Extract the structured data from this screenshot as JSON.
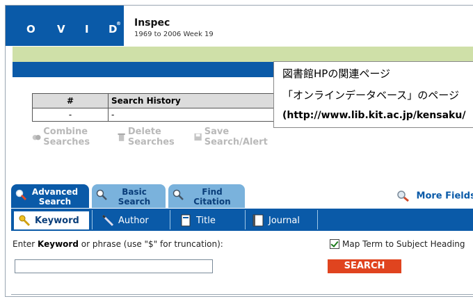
{
  "header": {
    "brand_letters": [
      "O",
      "V",
      "I",
      "D"
    ],
    "brand_mark": "®",
    "database_title": "Inspec",
    "database_range": "1969 to 2006 Week 19"
  },
  "overlay_note": {
    "line1": "図書館HPの関連ページ",
    "line2": "「オンラインデータベース」のページ",
    "line3": "(http://www.lib.kit.ac.jp/kensaku/"
  },
  "search_history": {
    "columns": [
      "#",
      "Search History"
    ],
    "rows": [
      [
        "-",
        "-"
      ]
    ]
  },
  "history_actions": {
    "combine": "Combine Searches",
    "delete": "Delete Searches",
    "save": "Save Search/Alert"
  },
  "search_tabs": [
    {
      "line1": "Advanced",
      "line2": "Search"
    },
    {
      "line1": "Basic",
      "line2": "Search"
    },
    {
      "line1": "Find",
      "line2": "Citation"
    }
  ],
  "more_fields": "More Fields",
  "field_tabs": {
    "keyword": "Keyword",
    "author": "Author",
    "title": "Title",
    "journal": "Journal"
  },
  "form": {
    "prompt_prefix": "Enter ",
    "prompt_bold": "Keyword",
    "prompt_suffix": " or phrase (use \"$\" for truncation):",
    "keyword_value": "",
    "map_term_label": "Map Term to Subject Heading",
    "map_term_checked": true,
    "search_button": "SEARCH"
  },
  "colors": {
    "ovid_blue": "#0a5aa8",
    "green_bar": "#cfe0a8",
    "search_red": "#e0441f",
    "inactive_tab": "#7ab2dc"
  }
}
